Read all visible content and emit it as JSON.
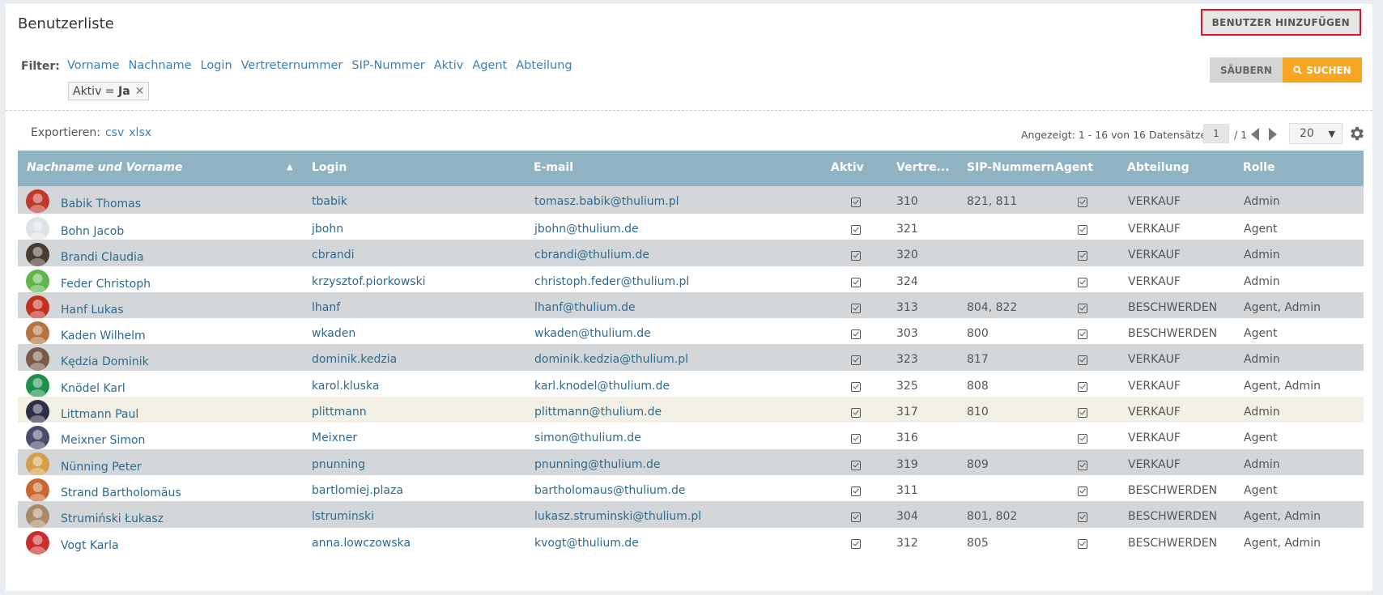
{
  "page": {
    "title": "Benutzerliste",
    "add_user_label": "BENUTZER HINZUFÜGEN"
  },
  "filter": {
    "label": "Filter:",
    "links": [
      "Vorname",
      "Nachname",
      "Login",
      "Vertreternummer",
      "SIP-Nummer",
      "Aktiv",
      "Agent",
      "Abteilung"
    ],
    "chip_key": "Aktiv = ",
    "chip_value": "Ja",
    "clear_label": "SÄUBERN",
    "search_label": "SUCHEN"
  },
  "export": {
    "label": "Exportieren:",
    "csv": "csv",
    "xlsx": "xlsx"
  },
  "pagination": {
    "shown_text": "Angezeigt: 1 - 16 von 16 Datensätze",
    "current_page": "1",
    "total_pages": "/ 1",
    "per_page": "20"
  },
  "table": {
    "columns": [
      "Nachname und Vorname",
      "Login",
      "E-mail",
      "Aktiv",
      "Vertre...",
      "SIP-Nummern",
      "Agent",
      "Abteilung",
      "Rolle"
    ],
    "sort_indicator": "▲",
    "rows": [
      {
        "name": "Babik Thomas",
        "login": "tbabik",
        "email": "tomasz.babik@thulium.pl",
        "vn": "310",
        "sip": "821, 811",
        "dept": "VERKAUF",
        "role": "Admin",
        "avatar_color": "#c0392b",
        "bg": "#d3d7da"
      },
      {
        "name": "Bohn Jacob",
        "login": "jbohn",
        "email": "jbohn@thulium.de",
        "vn": "321",
        "sip": "",
        "dept": "VERKAUF",
        "role": "Agent",
        "avatar_color": "#dfe3e6",
        "bg": "#ffffff"
      },
      {
        "name": "Brandi Claudia",
        "login": "cbrandi",
        "email": "cbrandi@thulium.de",
        "vn": "320",
        "sip": "",
        "dept": "VERKAUF",
        "role": "Admin",
        "avatar_color": "#4a3b32",
        "bg": "#d3d7da"
      },
      {
        "name": "Feder Christoph",
        "login": "krzysztof.piorkowski",
        "email": "christoph.feder@thulium.pl",
        "vn": "324",
        "sip": "",
        "dept": "VERKAUF",
        "role": "Admin",
        "avatar_color": "#5fb44b",
        "bg": "#ffffff"
      },
      {
        "name": "Hanf Lukas",
        "login": "lhanf",
        "email": "lhanf@thulium.de",
        "vn": "313",
        "sip": "804, 822",
        "dept": "BESCHWERDEN",
        "role": "Agent, Admin",
        "avatar_color": "#c0321e",
        "bg": "#d3d7da"
      },
      {
        "name": "Kaden Wilhelm",
        "login": "wkaden",
        "email": "wkaden@thulium.de",
        "vn": "303",
        "sip": "800",
        "dept": "BESCHWERDEN",
        "role": "Agent",
        "avatar_color": "#b5733f",
        "bg": "#ffffff"
      },
      {
        "name": "Kędzia Dominik",
        "login": "dominik.kedzia",
        "email": "dominik.kedzia@thulium.pl",
        "vn": "323",
        "sip": "817",
        "dept": "VERKAUF",
        "role": "Admin",
        "avatar_color": "#7a5a48",
        "bg": "#d3d7da"
      },
      {
        "name": "Knödel Karl",
        "login": "karol.kluska",
        "email": "karl.knodel@thulium.de",
        "vn": "325",
        "sip": "808",
        "dept": "VERKAUF",
        "role": "Agent, Admin",
        "avatar_color": "#1f8f4e",
        "bg": "#ffffff"
      },
      {
        "name": "Littmann Paul",
        "login": "plittmann",
        "email": "plittmann@thulium.de",
        "vn": "317",
        "sip": "810",
        "dept": "VERKAUF",
        "role": "Admin",
        "avatar_color": "#2c2f45",
        "bg": "#f2efe4"
      },
      {
        "name": "Meixner Simon",
        "login": "Meixner",
        "email": "simon@thulium.de",
        "vn": "316",
        "sip": "",
        "dept": "VERKAUF",
        "role": "Agent",
        "avatar_color": "#4b4b6b",
        "bg": "#ffffff"
      },
      {
        "name": "Nünning Peter",
        "login": "pnunning",
        "email": "pnunning@thulium.de",
        "vn": "319",
        "sip": "809",
        "dept": "VERKAUF",
        "role": "Admin",
        "avatar_color": "#d3a04a",
        "bg": "#d3d7da"
      },
      {
        "name": "Strand Bartholomäus",
        "login": "bartlomiej.plaza",
        "email": "bartholomaus@thulium.de",
        "vn": "311",
        "sip": "",
        "dept": "BESCHWERDEN",
        "role": "Agent",
        "avatar_color": "#c8682e",
        "bg": "#ffffff"
      },
      {
        "name": "Strumiński Łukasz",
        "login": "lstruminski",
        "email": "lukasz.struminski@thulium.pl",
        "vn": "304",
        "sip": "801, 802",
        "dept": "BESCHWERDEN",
        "role": "Agent, Admin",
        "avatar_color": "#a88a6a",
        "bg": "#d3d7da"
      },
      {
        "name": "Vogt Karla",
        "login": "anna.lowczowska",
        "email": "kvogt@thulium.de",
        "vn": "312",
        "sip": "805",
        "dept": "BESCHWERDEN",
        "role": "Agent, Admin",
        "avatar_color": "#c9302c",
        "bg": "#ffffff"
      }
    ]
  }
}
